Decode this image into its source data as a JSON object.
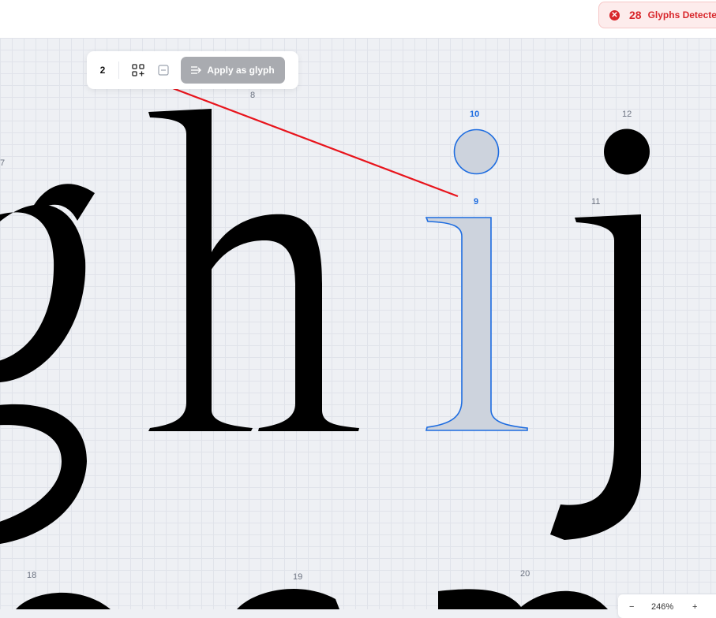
{
  "header": {
    "glyph_count": "28",
    "glyph_label": "Glyphs Detected"
  },
  "toolbar": {
    "selected_count": "2",
    "apply_label": "Apply as glyph"
  },
  "glyph_numbers": [
    "7",
    "8",
    "10",
    "12",
    "9",
    "11",
    "18",
    "19",
    "20"
  ],
  "zoom": {
    "minus": "−",
    "value": "246%",
    "plus": "+"
  },
  "colors": {
    "selection": "#1d6ce0",
    "alert": "#d8262b",
    "annotation_arrow": "#e8141c"
  }
}
